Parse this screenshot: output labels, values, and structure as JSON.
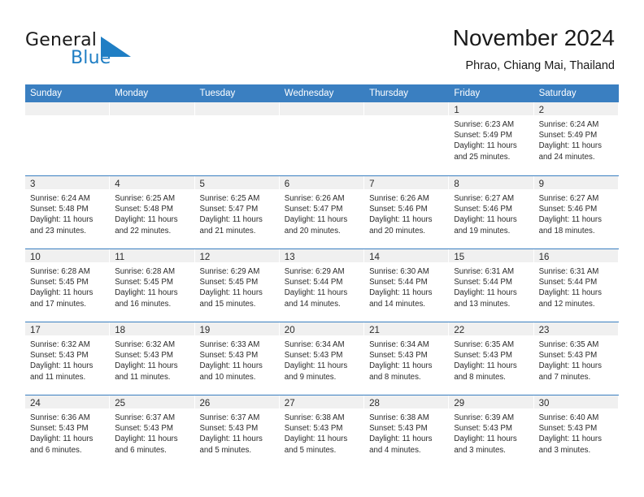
{
  "brand": {
    "name_part1": "General",
    "name_part2": "Blue",
    "mark_icon": "triangle-flag-icon",
    "accent_color": "#1f7ec4"
  },
  "header": {
    "title": "November 2024",
    "subtitle": "Phrao, Chiang Mai, Thailand"
  },
  "calendar": {
    "header_background": "#3a7fc1",
    "day_band_background": "#f0f0f0",
    "weekdays": [
      "Sunday",
      "Monday",
      "Tuesday",
      "Wednesday",
      "Thursday",
      "Friday",
      "Saturday"
    ],
    "weeks": [
      [
        {
          "day": "",
          "lines": []
        },
        {
          "day": "",
          "lines": []
        },
        {
          "day": "",
          "lines": []
        },
        {
          "day": "",
          "lines": []
        },
        {
          "day": "",
          "lines": []
        },
        {
          "day": "1",
          "lines": [
            "Sunrise: 6:23 AM",
            "Sunset: 5:49 PM",
            "Daylight: 11 hours",
            "and 25 minutes."
          ]
        },
        {
          "day": "2",
          "lines": [
            "Sunrise: 6:24 AM",
            "Sunset: 5:49 PM",
            "Daylight: 11 hours",
            "and 24 minutes."
          ]
        }
      ],
      [
        {
          "day": "3",
          "lines": [
            "Sunrise: 6:24 AM",
            "Sunset: 5:48 PM",
            "Daylight: 11 hours",
            "and 23 minutes."
          ]
        },
        {
          "day": "4",
          "lines": [
            "Sunrise: 6:25 AM",
            "Sunset: 5:48 PM",
            "Daylight: 11 hours",
            "and 22 minutes."
          ]
        },
        {
          "day": "5",
          "lines": [
            "Sunrise: 6:25 AM",
            "Sunset: 5:47 PM",
            "Daylight: 11 hours",
            "and 21 minutes."
          ]
        },
        {
          "day": "6",
          "lines": [
            "Sunrise: 6:26 AM",
            "Sunset: 5:47 PM",
            "Daylight: 11 hours",
            "and 20 minutes."
          ]
        },
        {
          "day": "7",
          "lines": [
            "Sunrise: 6:26 AM",
            "Sunset: 5:46 PM",
            "Daylight: 11 hours",
            "and 20 minutes."
          ]
        },
        {
          "day": "8",
          "lines": [
            "Sunrise: 6:27 AM",
            "Sunset: 5:46 PM",
            "Daylight: 11 hours",
            "and 19 minutes."
          ]
        },
        {
          "day": "9",
          "lines": [
            "Sunrise: 6:27 AM",
            "Sunset: 5:46 PM",
            "Daylight: 11 hours",
            "and 18 minutes."
          ]
        }
      ],
      [
        {
          "day": "10",
          "lines": [
            "Sunrise: 6:28 AM",
            "Sunset: 5:45 PM",
            "Daylight: 11 hours",
            "and 17 minutes."
          ]
        },
        {
          "day": "11",
          "lines": [
            "Sunrise: 6:28 AM",
            "Sunset: 5:45 PM",
            "Daylight: 11 hours",
            "and 16 minutes."
          ]
        },
        {
          "day": "12",
          "lines": [
            "Sunrise: 6:29 AM",
            "Sunset: 5:45 PM",
            "Daylight: 11 hours",
            "and 15 minutes."
          ]
        },
        {
          "day": "13",
          "lines": [
            "Sunrise: 6:29 AM",
            "Sunset: 5:44 PM",
            "Daylight: 11 hours",
            "and 14 minutes."
          ]
        },
        {
          "day": "14",
          "lines": [
            "Sunrise: 6:30 AM",
            "Sunset: 5:44 PM",
            "Daylight: 11 hours",
            "and 14 minutes."
          ]
        },
        {
          "day": "15",
          "lines": [
            "Sunrise: 6:31 AM",
            "Sunset: 5:44 PM",
            "Daylight: 11 hours",
            "and 13 minutes."
          ]
        },
        {
          "day": "16",
          "lines": [
            "Sunrise: 6:31 AM",
            "Sunset: 5:44 PM",
            "Daylight: 11 hours",
            "and 12 minutes."
          ]
        }
      ],
      [
        {
          "day": "17",
          "lines": [
            "Sunrise: 6:32 AM",
            "Sunset: 5:43 PM",
            "Daylight: 11 hours",
            "and 11 minutes."
          ]
        },
        {
          "day": "18",
          "lines": [
            "Sunrise: 6:32 AM",
            "Sunset: 5:43 PM",
            "Daylight: 11 hours",
            "and 11 minutes."
          ]
        },
        {
          "day": "19",
          "lines": [
            "Sunrise: 6:33 AM",
            "Sunset: 5:43 PM",
            "Daylight: 11 hours",
            "and 10 minutes."
          ]
        },
        {
          "day": "20",
          "lines": [
            "Sunrise: 6:34 AM",
            "Sunset: 5:43 PM",
            "Daylight: 11 hours",
            "and 9 minutes."
          ]
        },
        {
          "day": "21",
          "lines": [
            "Sunrise: 6:34 AM",
            "Sunset: 5:43 PM",
            "Daylight: 11 hours",
            "and 8 minutes."
          ]
        },
        {
          "day": "22",
          "lines": [
            "Sunrise: 6:35 AM",
            "Sunset: 5:43 PM",
            "Daylight: 11 hours",
            "and 8 minutes."
          ]
        },
        {
          "day": "23",
          "lines": [
            "Sunrise: 6:35 AM",
            "Sunset: 5:43 PM",
            "Daylight: 11 hours",
            "and 7 minutes."
          ]
        }
      ],
      [
        {
          "day": "24",
          "lines": [
            "Sunrise: 6:36 AM",
            "Sunset: 5:43 PM",
            "Daylight: 11 hours",
            "and 6 minutes."
          ]
        },
        {
          "day": "25",
          "lines": [
            "Sunrise: 6:37 AM",
            "Sunset: 5:43 PM",
            "Daylight: 11 hours",
            "and 6 minutes."
          ]
        },
        {
          "day": "26",
          "lines": [
            "Sunrise: 6:37 AM",
            "Sunset: 5:43 PM",
            "Daylight: 11 hours",
            "and 5 minutes."
          ]
        },
        {
          "day": "27",
          "lines": [
            "Sunrise: 6:38 AM",
            "Sunset: 5:43 PM",
            "Daylight: 11 hours",
            "and 5 minutes."
          ]
        },
        {
          "day": "28",
          "lines": [
            "Sunrise: 6:38 AM",
            "Sunset: 5:43 PM",
            "Daylight: 11 hours",
            "and 4 minutes."
          ]
        },
        {
          "day": "29",
          "lines": [
            "Sunrise: 6:39 AM",
            "Sunset: 5:43 PM",
            "Daylight: 11 hours",
            "and 3 minutes."
          ]
        },
        {
          "day": "30",
          "lines": [
            "Sunrise: 6:40 AM",
            "Sunset: 5:43 PM",
            "Daylight: 11 hours",
            "and 3 minutes."
          ]
        }
      ]
    ]
  }
}
